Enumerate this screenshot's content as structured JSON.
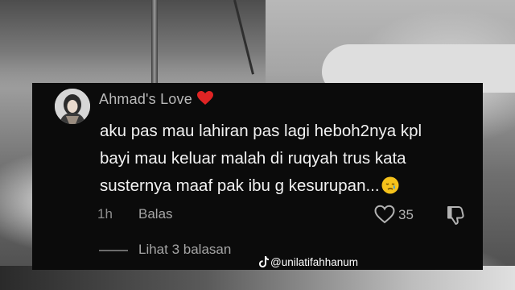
{
  "comment": {
    "username": "Ahmad's Love",
    "username_emoji": "red-heart",
    "text_lines": [
      "aku pas mau lahiran pas lagi heboh2nya kpl",
      "bayi mau keluar malah di ruqyah trus kata",
      "susternya maaf pak ibu g kesurupan..."
    ],
    "text_emoji": "sad-relieved-face",
    "time": "1h",
    "reply_label": "Balas",
    "like_count": "35",
    "view_replies": "Lihat 3 balasan"
  },
  "watermark": {
    "handle": "@unilatifahhanum",
    "icon": "tiktok-icon"
  },
  "colors": {
    "card_bg": "#0b0b0b",
    "heart": "#e02424",
    "text_primary": "#f2f2f2",
    "text_muted": "#8d8d8d"
  }
}
